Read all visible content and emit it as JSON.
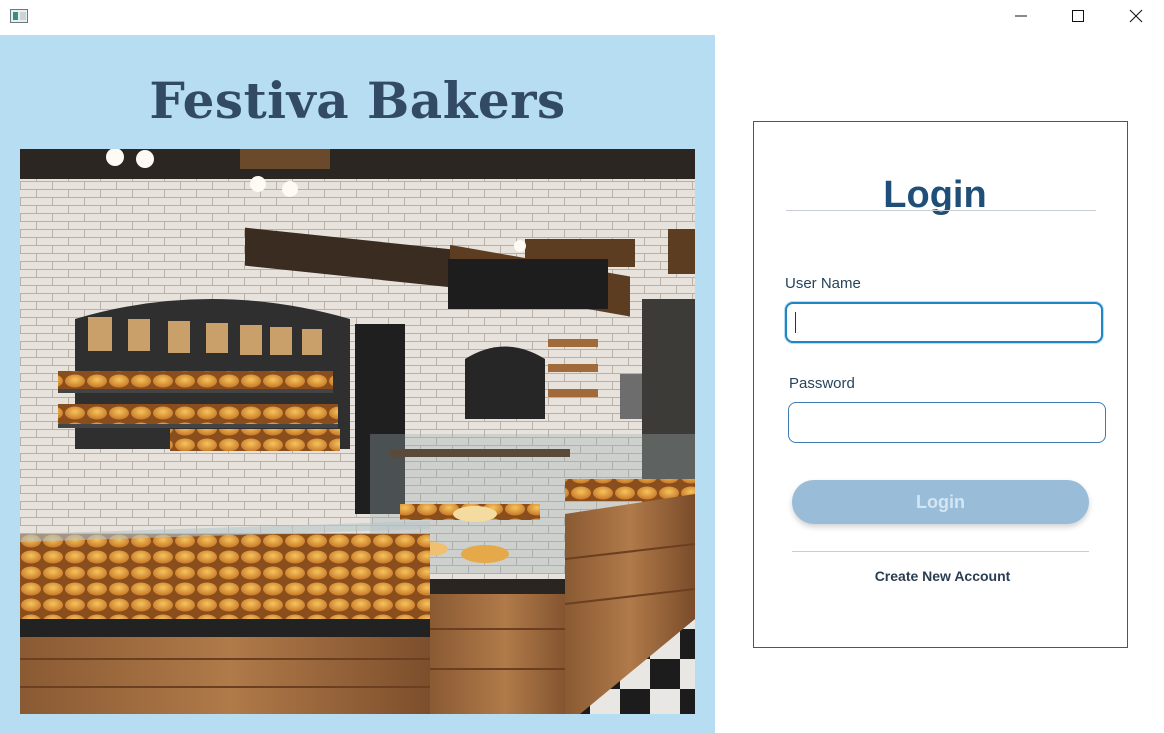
{
  "window": {
    "app_icon": "app-window-icon",
    "controls": [
      "minimize-icon",
      "maximize-icon",
      "close-icon"
    ]
  },
  "brand": {
    "title": "Festiva Bakers",
    "title_color": "#324a66",
    "panel_color": "#b6ddf1",
    "photo": "bakery-interior-photo"
  },
  "login": {
    "title": "Login",
    "username_label": "User Name",
    "username_value": "",
    "password_label": "Password",
    "password_value": "",
    "submit_label": "Login",
    "create_account_label": "Create New Account",
    "accent_color": "#1f4f78",
    "button_color": "#99bdd8"
  }
}
